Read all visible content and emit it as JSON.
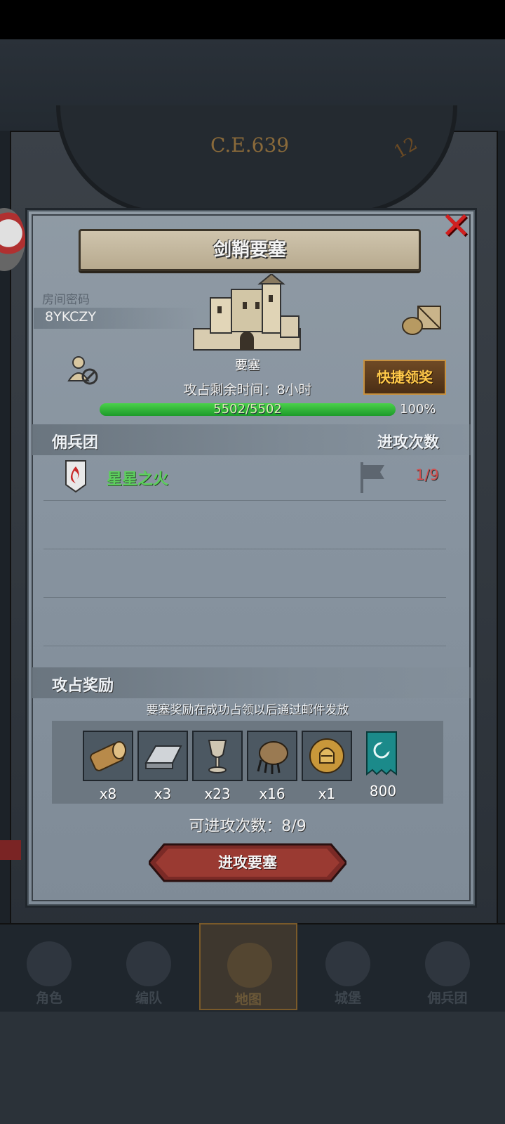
{
  "header": {
    "era": "C.E.639",
    "dial_number": "12"
  },
  "dialog": {
    "title": "剑鞘要塞",
    "room_label": "房间密码",
    "room_code": "8YKCZY",
    "building_label": "要塞",
    "quick_claim_label": "快捷领奖",
    "timer_text": "攻占剩余时间：8小时",
    "hp": {
      "current": 5502,
      "max": 5502,
      "text": "5502/5502",
      "percent_text": "100%",
      "fill_fraction": 1.0
    },
    "colors": {
      "hp_fill": "#2fb83a",
      "guild_name": "#5cd05c",
      "attack_count": "#d05050",
      "quick_button_text": "#ffc94a"
    }
  },
  "mercenary_section": {
    "title": "佣兵团",
    "count_header": "进攻次数",
    "rows": [
      {
        "name": "星星之火",
        "count": "1/9",
        "icon": "fire-shield-icon"
      }
    ]
  },
  "reward_section": {
    "title": "攻占奖励",
    "note": "要塞奖励在成功占领以后通过邮件发放",
    "items": [
      {
        "icon": "wood-log-icon",
        "qty": "x8"
      },
      {
        "icon": "iron-ingot-icon",
        "qty": "x3"
      },
      {
        "icon": "goblet-icon",
        "qty": "x23"
      },
      {
        "icon": "beast-claw-icon",
        "qty": "x16"
      },
      {
        "icon": "knight-helmet-coin-icon",
        "qty": "x1"
      },
      {
        "icon": "banner-icon",
        "qty": "800"
      }
    ],
    "attempts_text": "可进攻次数：8/9",
    "attack_button": "进攻要塞"
  },
  "nav": [
    {
      "label": "角色",
      "icon": "character-icon",
      "active": false
    },
    {
      "label": "编队",
      "icon": "formation-icon",
      "active": false
    },
    {
      "label": "地图",
      "icon": "map-compass-icon",
      "active": true
    },
    {
      "label": "城堡",
      "icon": "castle-nav-icon",
      "active": false
    },
    {
      "label": "佣兵团",
      "icon": "mercenary-icon",
      "active": false
    }
  ]
}
